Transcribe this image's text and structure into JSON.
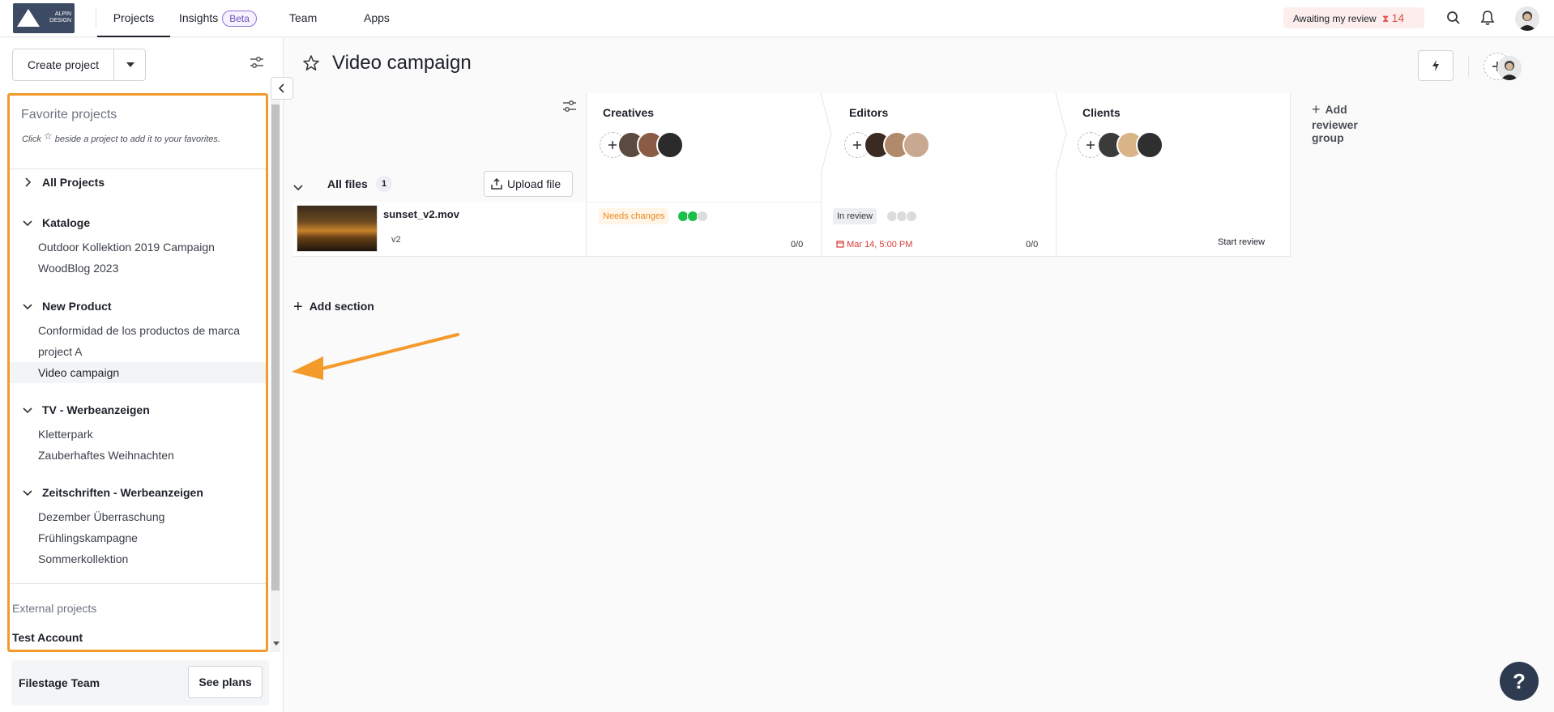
{
  "topbar": {
    "logo_text": "ALPIN\nDESIGN",
    "nav": [
      {
        "label": "Projects",
        "active": true
      },
      {
        "label": "Insights",
        "badge": "Beta"
      },
      {
        "label": "Team"
      },
      {
        "label": "Apps"
      }
    ],
    "awaiting_label": "Awaiting my review",
    "awaiting_icon": "hourglass-icon",
    "awaiting_count": "14",
    "icons": [
      "search-icon",
      "bell-icon",
      "user-avatar"
    ]
  },
  "sidebar": {
    "create_project_label": "Create project",
    "favorites_title": "Favorite projects",
    "favorites_hint_before": "Click",
    "favorites_hint_after": "beside a project to add it to your favorites.",
    "all_projects_label": "All Projects",
    "groups": [
      {
        "name": "Kataloge",
        "items": [
          "Outdoor Kollektion 2019 Campaign",
          "WoodBlog 2023"
        ]
      },
      {
        "name": "New Product",
        "items": [
          "Conformidad de los productos de marca",
          "project A",
          "Video campaign"
        ]
      },
      {
        "name": "TV - Werbeanzeigen",
        "items": [
          "Kletterpark",
          "Zauberhaftes Weihnachten"
        ]
      },
      {
        "name": "Zeitschriften - Werbeanzeigen",
        "items": [
          "Dezember Überraschung",
          "Frühlingskampagne",
          "Sommerkollektion"
        ]
      }
    ],
    "selected_item": "Video campaign",
    "external_title": "External projects",
    "external_items": [
      "Test Account"
    ],
    "team_name": "Filestage Team",
    "see_plans_label": "See plans"
  },
  "project": {
    "title": "Video campaign",
    "columns": [
      {
        "name": "Creatives"
      },
      {
        "name": "Editors"
      },
      {
        "name": "Clients"
      }
    ],
    "add_reviewer_group_label": "Add reviewer group",
    "section": {
      "name": "All files",
      "count": "1",
      "upload_label": "Upload file"
    },
    "file": {
      "name": "sunset_v2.mov",
      "version": "v2",
      "creatives_status": "Needs changes",
      "creatives_comments": "0/0",
      "editors_status": "In review",
      "editors_due": "Mar 14, 5:00 PM",
      "editors_comments": "0/0",
      "clients_action": "Start review"
    },
    "add_section_label": "Add section"
  },
  "help_label": "?",
  "colors": {
    "accent_orange": "#f39a2b",
    "status_green": "#1bbf4b",
    "due_red": "#d63b35",
    "beta_purple": "#6b53bf"
  }
}
